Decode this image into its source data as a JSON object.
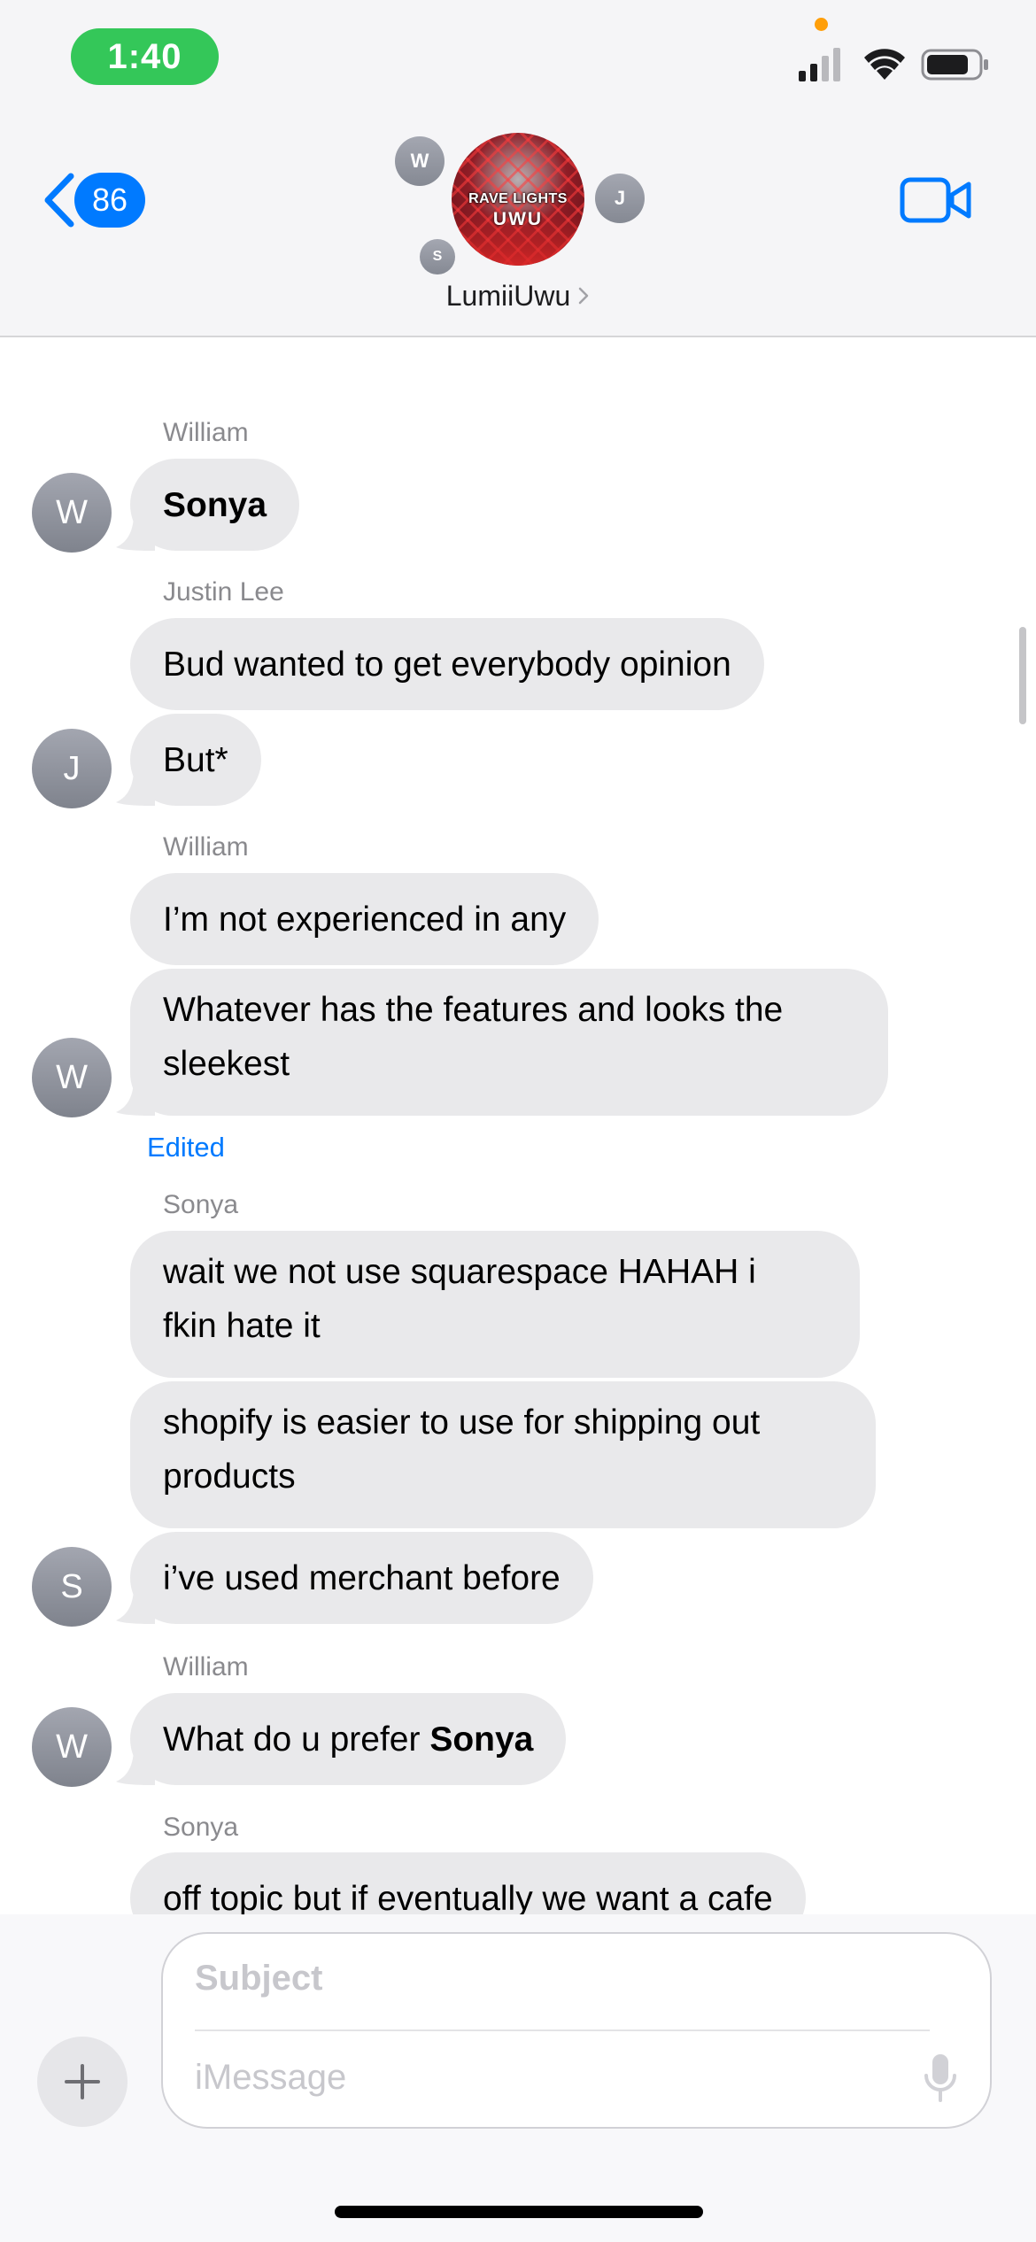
{
  "status_bar": {
    "time": "1:40",
    "cellular_icon": "cellular-signal-icon",
    "wifi_icon": "wifi-icon",
    "battery_icon": "battery-icon"
  },
  "header": {
    "back_count": "86",
    "group_name": "LumiiUwu",
    "group_avatar_text_line1": "RAVE LIGHTS",
    "group_avatar_text_line2": "UWU",
    "member_initials": [
      "W",
      "J",
      "S"
    ],
    "video_icon": "video-camera-icon"
  },
  "messages": [
    {
      "sender": "William",
      "avatar": "W",
      "bubbles": [
        {
          "parts": [
            {
              "text": "Sonya",
              "bold": true
            }
          ]
        }
      ]
    },
    {
      "sender": "Justin Lee",
      "avatar": "J",
      "bubbles": [
        {
          "text": "Bud wanted to get everybody opinion"
        },
        {
          "text": "But*"
        }
      ]
    },
    {
      "sender": "William",
      "avatar": "W",
      "bubbles": [
        {
          "text": "I’m not experienced in any"
        },
        {
          "line1": "Whatever has the features and looks the",
          "line2": "sleekest"
        }
      ],
      "status": "Edited"
    },
    {
      "sender": "Sonya",
      "avatar": "S",
      "bubbles": [
        {
          "line1": "wait we not use squarespace HAHAH i",
          "line2": "fkin hate it"
        },
        {
          "line1": "shopify is easier to use for shipping out",
          "line2": "products"
        },
        {
          "text": "i’ve used merchant before"
        }
      ]
    },
    {
      "sender": "William",
      "avatar": "W",
      "bubbles": [
        {
          "parts": [
            {
              "text": "What do u prefer "
            },
            {
              "text": "Sonya",
              "bold": true
            }
          ]
        }
      ]
    },
    {
      "sender": "Sonya",
      "avatar": "S",
      "bubbles": [
        {
          "text": "off topic but if eventually we want a cafe"
        }
      ]
    }
  ],
  "composer": {
    "subject_placeholder": "Subject",
    "message_placeholder": "iMessage",
    "plus_icon": "plus-icon",
    "mic_icon": "microphone-icon"
  },
  "colors": {
    "accent": "#007aff",
    "bubble_received": "#e9e9eb",
    "time_pill": "#34c759",
    "privacy_dot": "#ff9f0a"
  }
}
